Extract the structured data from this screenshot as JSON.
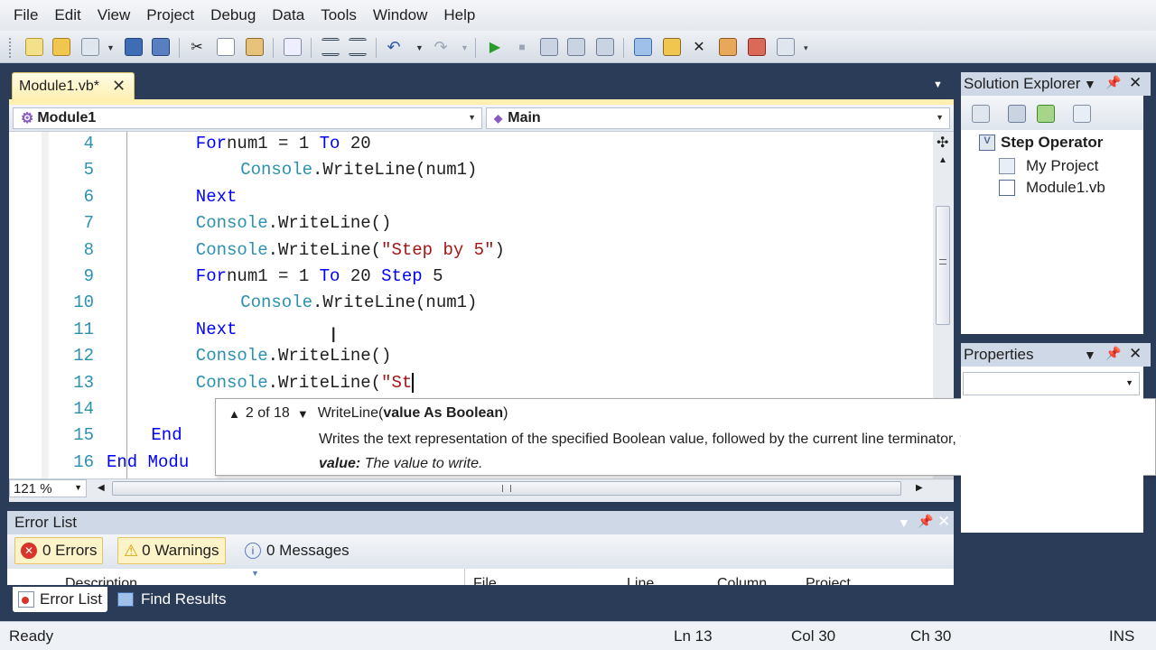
{
  "menu": [
    "File",
    "Edit",
    "View",
    "Project",
    "Debug",
    "Data",
    "Tools",
    "Window",
    "Help"
  ],
  "tab": {
    "label": "Module1.vb*",
    "close": "✕"
  },
  "nav": {
    "left": "Module1",
    "right": "Main"
  },
  "code_lines": [
    {
      "num": "4",
      "indent": 2,
      "tokens": [
        [
          "kw",
          "For"
        ],
        [
          "",
          "num1 = 1 "
        ],
        [
          "kw",
          "To"
        ],
        [
          "",
          " 20"
        ]
      ]
    },
    {
      "num": "5",
      "indent": 3,
      "tokens": [
        [
          "ty",
          "Console"
        ],
        [
          "",
          ".WriteLine(num1)"
        ]
      ]
    },
    {
      "num": "6",
      "indent": 2,
      "tokens": [
        [
          "kw",
          "Next"
        ]
      ]
    },
    {
      "num": "7",
      "indent": 2,
      "tokens": [
        [
          "ty",
          "Console"
        ],
        [
          "",
          ".WriteLine()"
        ]
      ]
    },
    {
      "num": "8",
      "indent": 2,
      "tokens": [
        [
          "ty",
          "Console"
        ],
        [
          "",
          ".WriteLine("
        ],
        [
          "str",
          "\"Step by 5\""
        ],
        [
          "",
          ")"
        ]
      ]
    },
    {
      "num": "9",
      "indent": 2,
      "tokens": [
        [
          "kw",
          "For"
        ],
        [
          "",
          "num1 = 1 "
        ],
        [
          "kw",
          "To"
        ],
        [
          "",
          " 20 "
        ],
        [
          "kw",
          "Step"
        ],
        [
          "",
          " 5"
        ]
      ]
    },
    {
      "num": "10",
      "indent": 3,
      "tokens": [
        [
          "ty",
          "Console"
        ],
        [
          "",
          ".WriteLine(num1)"
        ]
      ]
    },
    {
      "num": "11",
      "indent": 2,
      "tokens": [
        [
          "kw",
          "Next"
        ]
      ]
    },
    {
      "num": "12",
      "indent": 2,
      "tokens": [
        [
          "ty",
          "Console"
        ],
        [
          "",
          ".WriteLine()"
        ]
      ]
    },
    {
      "num": "13",
      "indent": 2,
      "tokens": [
        [
          "ty",
          "Console"
        ],
        [
          "",
          ".WriteLine("
        ],
        [
          "str",
          "\"St"
        ]
      ]
    },
    {
      "num": "14",
      "indent": 2,
      "tokens": []
    },
    {
      "num": "15",
      "indent": 1,
      "tokens": [
        [
          "kw",
          "End"
        ]
      ]
    },
    {
      "num": "16",
      "indent": 0,
      "tokens": [
        [
          "kw",
          "End Modu"
        ]
      ]
    }
  ],
  "tooltip": {
    "overload": "2 of 18",
    "sig_name": "WriteLine(",
    "sig_param": "value As Boolean",
    "sig_close": ")",
    "description": "Writes the text representation of the specified Boolean value, followed by the current line terminator, to the standard output",
    "param_name": "value:",
    "param_desc": "The value to write."
  },
  "zoom": "121 %",
  "solution_explorer": {
    "title": "Solution Explorer",
    "solution": "Step Operator",
    "items": [
      "My Project",
      "Module1.vb"
    ]
  },
  "properties": {
    "title": "Properties"
  },
  "error_list": {
    "title": "Error List",
    "errors": "0 Errors",
    "warnings": "0 Warnings",
    "messages": "0 Messages",
    "columns": [
      "Description",
      "File",
      "Line",
      "Column",
      "Project"
    ]
  },
  "bottom_tabs": [
    "Error List",
    "Find Results"
  ],
  "status": {
    "ready": "Ready",
    "ln": "Ln 13",
    "col": "Col 30",
    "ch": "Ch 30",
    "ins": "INS"
  },
  "colors": {
    "keyword": "#0000ff",
    "type": "#2b91af",
    "string": "#a31515",
    "chrome": "#2b3c59",
    "tab_active": "#fff0b2"
  }
}
